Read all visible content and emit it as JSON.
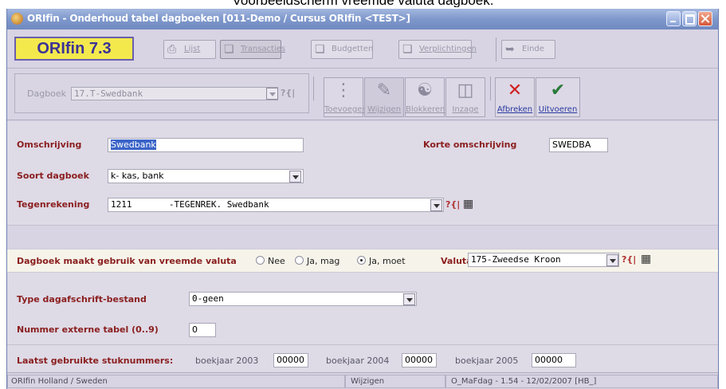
{
  "caption": "Voorbeeldscherm vreemde valuta dagboek.",
  "window": {
    "title": "ORIfin - Onderhoud tabel dagboeken [011-Demo / Cursus ORIfin <TEST>]"
  },
  "toolbar": {
    "logo": "ORIfin 7.3",
    "buttons": [
      {
        "label": "Lijst",
        "icon": "printer-icon"
      },
      {
        "label": "Transacties",
        "icon": "docs-icon"
      },
      {
        "label": "Budgetten",
        "icon": "docs-icon"
      },
      {
        "label": "Verplichtingen",
        "icon": "docs-icon"
      },
      {
        "label": "Einde",
        "icon": "exit-icon"
      }
    ]
  },
  "dagboek": {
    "label": "Dagboek",
    "value": "17.T-Swedbank"
  },
  "actions": [
    {
      "label": "Toevoegen",
      "icon": "add-icon"
    },
    {
      "label": "Wijzigen",
      "icon": "edit-icon"
    },
    {
      "label": "Blokkeren",
      "icon": "lock-icon"
    },
    {
      "label": "Inzage",
      "icon": "view-icon"
    },
    {
      "label": "Afbreken",
      "icon": "abort-icon"
    },
    {
      "label": "Uitvoeren",
      "icon": "execute-icon"
    }
  ],
  "form": {
    "omschrijving_label": "Omschrijving",
    "omschrijving_value": "Swedbank",
    "korte_label": "Korte omschrijving",
    "korte_value": "SWEDBA",
    "soort_label": "Soort dagboek",
    "soort_value": "k- kas, bank",
    "tegenrekening_label": "Tegenrekening",
    "tegenrekening_value": "1211       -TEGENREK. Swedbank"
  },
  "valuta": {
    "question": "Dagboek maakt gebruik van vreemde valuta",
    "options": [
      "Nee",
      "Ja, mag",
      "Ja, moet"
    ],
    "selected": "Ja, moet",
    "valuta_label": "Valuta",
    "valuta_value": "175-Zweedse Kroon"
  },
  "form2": {
    "type_label": "Type dagafschrift-bestand",
    "type_value": "0-geen",
    "nummer_label": "Nummer externe tabel (0..9)",
    "nummer_value": "0"
  },
  "stuknummers": {
    "label": "Laatst gebruikte stuknummers:",
    "years": [
      {
        "label": "boekjaar 2003",
        "value": "00000"
      },
      {
        "label": "boekjaar 2004",
        "value": "00000"
      },
      {
        "label": "boekjaar 2005",
        "value": "00000"
      }
    ]
  },
  "status": {
    "left": "ORIfin Holland / Sweden",
    "mode": "Wijzigen",
    "right": "O_MaFdag - 1.54 - 12/02/2007 [HB_]"
  },
  "colors": {
    "label_red": "#8a1e1e",
    "logo_yellow": "#f3e94d",
    "title_blue": "#7f98cc"
  }
}
